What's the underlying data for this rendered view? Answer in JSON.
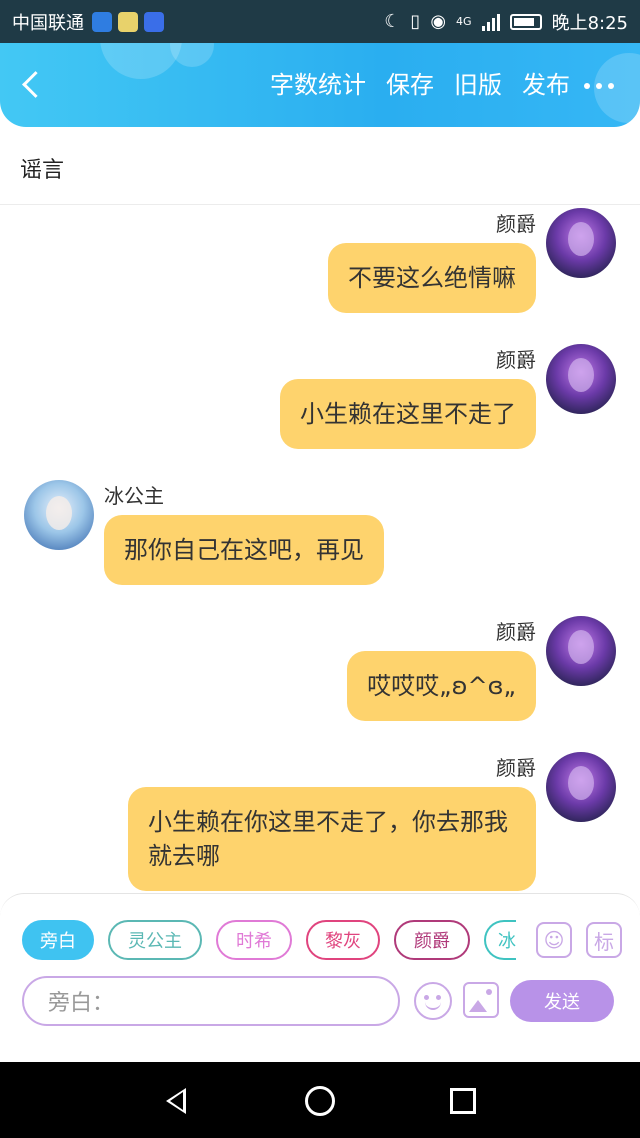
{
  "status_bar": {
    "carrier": "中国联通",
    "network": "4G",
    "time": "晚上8:25"
  },
  "header": {
    "actions": [
      "字数统计",
      "保存",
      "旧版",
      "发布"
    ]
  },
  "document": {
    "title": "谣言"
  },
  "messages": [
    {
      "speaker": "颜爵",
      "text": "不要这么绝情嘛"
    },
    {
      "speaker": "颜爵",
      "text": "小生赖在这里不走了"
    },
    {
      "speaker": "冰公主",
      "text": "那你自己在这吧，再见"
    },
    {
      "speaker": "颜爵",
      "text": "哎哎哎„ʚ^ɞ„"
    },
    {
      "speaker": "颜爵",
      "text": "小生赖在你这里不走了，你去那我就去哪"
    }
  ],
  "characters": [
    {
      "label": "旁白",
      "active": true,
      "color": "#3fc3f1"
    },
    {
      "label": "灵公主",
      "active": false,
      "color": "#5bb8b4"
    },
    {
      "label": "时希",
      "active": false,
      "color": "#e07ad6"
    },
    {
      "label": "黎灰",
      "active": false,
      "color": "#e0447e"
    },
    {
      "label": "颜爵",
      "active": false,
      "color": "#b03a7a"
    },
    {
      "label": "冰",
      "active": false,
      "color": "#3fc3c1"
    }
  ],
  "tools": {
    "character_icon": "person-icon",
    "tag_label": "标"
  },
  "composer": {
    "placeholder": "旁白：",
    "send_label": "发送"
  },
  "colors": {
    "header": "#2aaef0",
    "bubble": "#fed36d",
    "accent": "#b892e8"
  }
}
